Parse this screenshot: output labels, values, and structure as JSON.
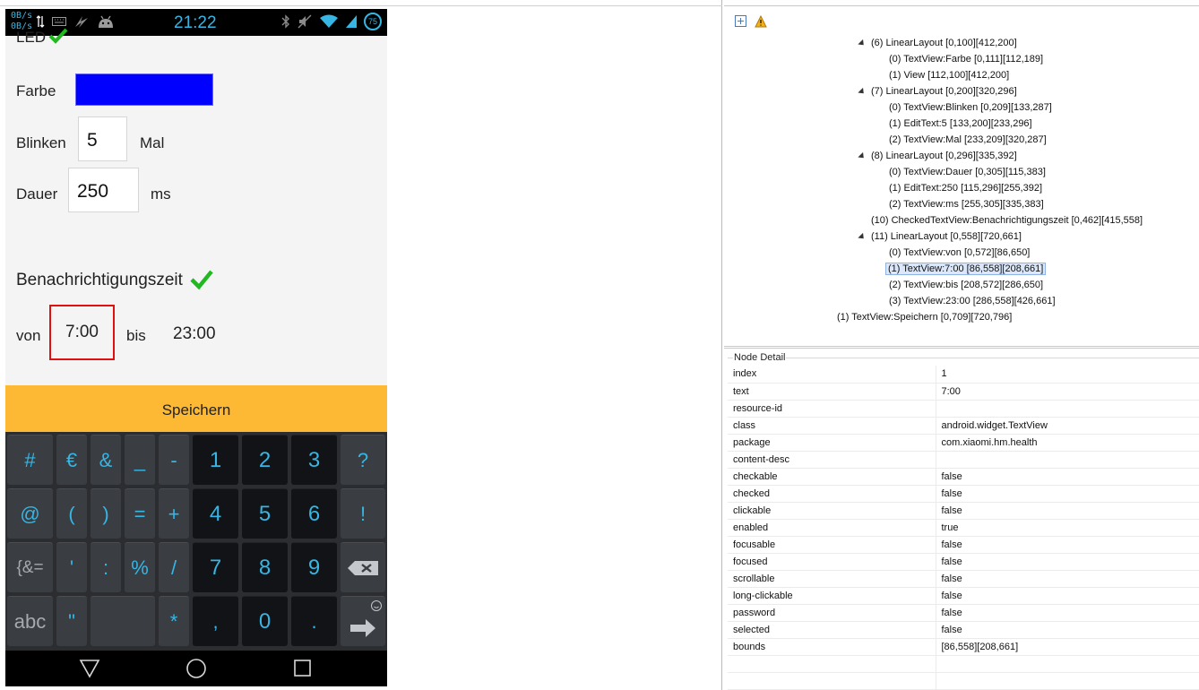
{
  "status_bar": {
    "net_up": "0B/s",
    "net_down": "0B/s",
    "time": "21:22",
    "battery": "75",
    "colors": {
      "accent": "#35b6e5"
    }
  },
  "app": {
    "led_label": "LED",
    "farbe_label": "Farbe",
    "farbe_color": "#0000ff",
    "blinken_label": "Blinken",
    "blinken_value": "5",
    "mal_label": "Mal",
    "dauer_label": "Dauer",
    "dauer_value": "250",
    "ms_label": "ms",
    "notify_label": "Benachrichtigungszeit",
    "von_label": "von",
    "from_time": "7:00",
    "bis_label": "bis",
    "to_time": "23:00",
    "save_label": "Speichern",
    "colors": {
      "check": "#22b822",
      "save_bg": "#fdb933",
      "highlight": "#e01010"
    }
  },
  "keyboard": {
    "rows": [
      [
        "#",
        "€",
        "&",
        "_",
        "-",
        "1",
        "2",
        "3",
        "?"
      ],
      [
        "@",
        "(",
        ")",
        "=",
        "+",
        "4",
        "5",
        "6",
        "!"
      ],
      [
        "{&=",
        "'",
        ":",
        "%",
        "/",
        "7",
        "8",
        "9",
        "backspace-icon"
      ],
      [
        "abc",
        "\"",
        "",
        "*",
        ",",
        "0",
        ".",
        "enter-icon"
      ]
    ]
  },
  "tree": {
    "nodes": [
      {
        "text": "(6) LinearLayout [0,100][412,200]",
        "expander": true
      },
      {
        "text": "(0) TextView:Farbe [0,111][112,189]"
      },
      {
        "text": "(1) View [112,100][412,200]"
      },
      {
        "text": "(7) LinearLayout [0,200][320,296]",
        "expander": true
      },
      {
        "text": "(0) TextView:Blinken [0,209][133,287]"
      },
      {
        "text": "(1) EditText:5 [133,200][233,296]"
      },
      {
        "text": "(2) TextView:Mal [233,209][320,287]"
      },
      {
        "text": "(8) LinearLayout [0,296][335,392]",
        "expander": true
      },
      {
        "text": "(0) TextView:Dauer [0,305][115,383]"
      },
      {
        "text": "(1) EditText:250 [115,296][255,392]"
      },
      {
        "text": "(2) TextView:ms [255,305][335,383]"
      },
      {
        "text": "(10) CheckedTextView:Benachrichtigungszeit [0,462][415,558]"
      },
      {
        "text": "(11) LinearLayout [0,558][720,661]",
        "expander": true
      },
      {
        "text": "(0) TextView:von [0,572][86,650]"
      },
      {
        "text": "(1) TextView:7:00 [86,558][208,661]",
        "selected": true
      },
      {
        "text": "(2) TextView:bis [208,572][286,650]"
      },
      {
        "text": "(3) TextView:23:00 [286,558][426,661]"
      },
      {
        "text": "(1) TextView:Speichern [0,709][720,796]"
      }
    ]
  },
  "node_detail": {
    "title": "Node Detail",
    "rows": [
      {
        "key": "index",
        "value": "1"
      },
      {
        "key": "text",
        "value": "7:00"
      },
      {
        "key": "resource-id",
        "value": ""
      },
      {
        "key": "class",
        "value": "android.widget.TextView"
      },
      {
        "key": "package",
        "value": "com.xiaomi.hm.health"
      },
      {
        "key": "content-desc",
        "value": ""
      },
      {
        "key": "checkable",
        "value": "false"
      },
      {
        "key": "checked",
        "value": "false"
      },
      {
        "key": "clickable",
        "value": "false"
      },
      {
        "key": "enabled",
        "value": "true"
      },
      {
        "key": "focusable",
        "value": "false"
      },
      {
        "key": "focused",
        "value": "false"
      },
      {
        "key": "scrollable",
        "value": "false"
      },
      {
        "key": "long-clickable",
        "value": "false"
      },
      {
        "key": "password",
        "value": "false"
      },
      {
        "key": "selected",
        "value": "false"
      },
      {
        "key": "bounds",
        "value": "[86,558][208,661]"
      },
      {
        "key": "",
        "value": ""
      },
      {
        "key": "",
        "value": ""
      }
    ]
  }
}
